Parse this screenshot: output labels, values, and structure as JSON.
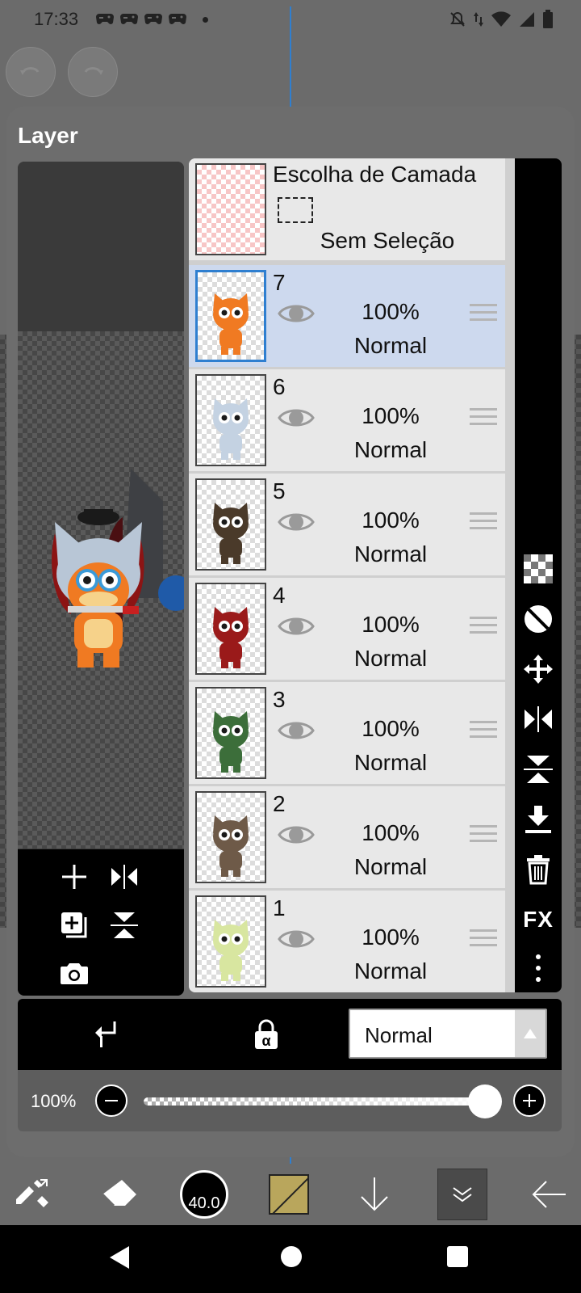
{
  "status_bar": {
    "time": "17:33",
    "notification_icons": [
      "game-controller-icon",
      "game-controller-icon",
      "game-controller-icon",
      "game-controller-icon"
    ],
    "right_icons": [
      "mute-icon",
      "data-arrows-icon",
      "wifi-icon",
      "signal-icon",
      "battery-icon"
    ]
  },
  "panel": {
    "title": "Layer"
  },
  "selection_layer": {
    "title": "Escolha de Camada",
    "subtitle": "Sem Seleção"
  },
  "layers": [
    {
      "number": "7",
      "opacity": "100%",
      "blend": "Normal",
      "selected": true,
      "color": "#f07a22"
    },
    {
      "number": "6",
      "opacity": "100%",
      "blend": "Normal",
      "selected": false,
      "color": "#c4d2e2"
    },
    {
      "number": "5",
      "opacity": "100%",
      "blend": "Normal",
      "selected": false,
      "color": "#4a3a2a"
    },
    {
      "number": "4",
      "opacity": "100%",
      "blend": "Normal",
      "selected": false,
      "color": "#9a1a1a"
    },
    {
      "number": "3",
      "opacity": "100%",
      "blend": "Normal",
      "selected": false,
      "color": "#3c6e3a"
    },
    {
      "number": "2",
      "opacity": "100%",
      "blend": "Normal",
      "selected": false,
      "color": "#6e5a48"
    },
    {
      "number": "1",
      "opacity": "100%",
      "blend": "Normal",
      "selected": false,
      "color": "#d8e6a0"
    }
  ],
  "side_tools": [
    "checker-icon",
    "circle-slash-icon",
    "move-icon",
    "flip-horizontal-icon",
    "flip-vertical-icon",
    "merge-down-icon",
    "trash-icon",
    "FX",
    "more-vertical-icon"
  ],
  "blend_bar": {
    "mode": "Normal"
  },
  "opacity_bar": {
    "label": "100%",
    "value": 1.0
  },
  "toolbar": {
    "brush_size": "40.0",
    "color": "#b9a65c"
  }
}
